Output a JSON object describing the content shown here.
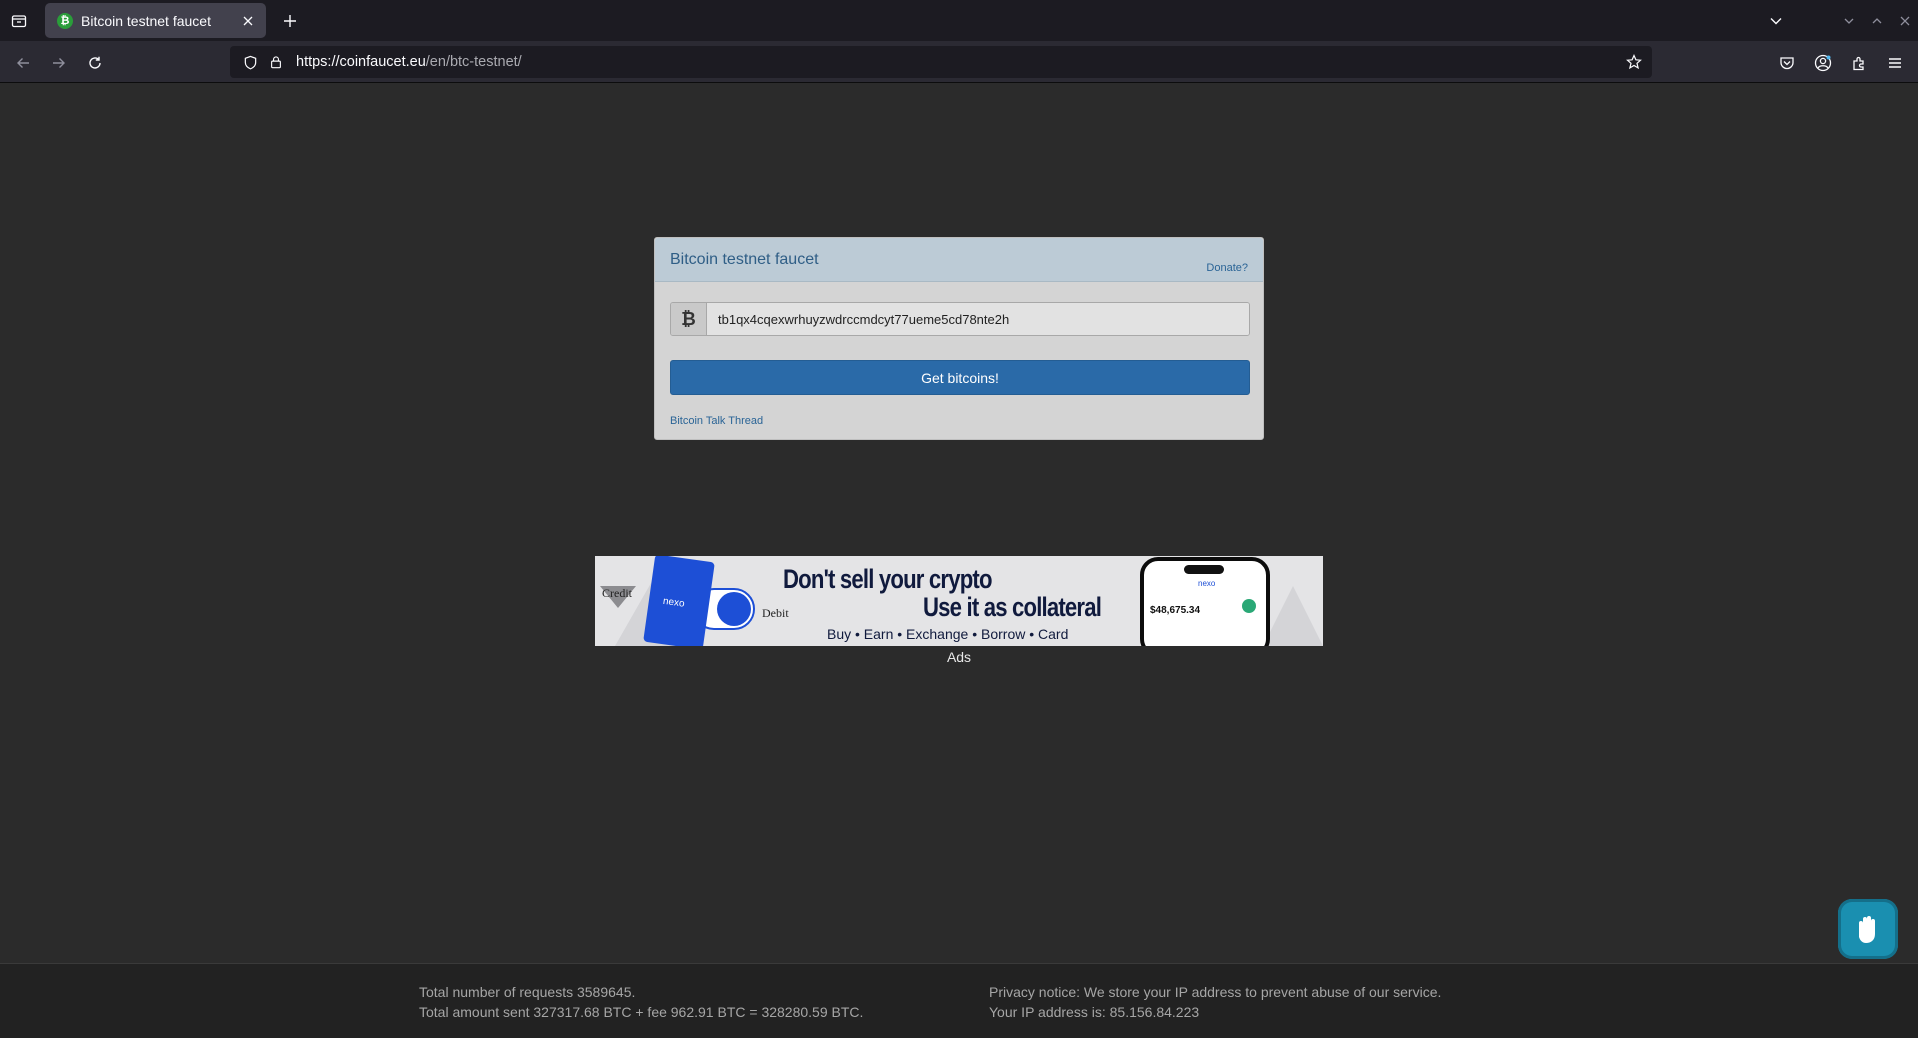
{
  "browser": {
    "tab_title": "Bitcoin testnet faucet",
    "url_host": "https://coinfaucet.eu",
    "url_path": "/en/btc-testnet/"
  },
  "faucet": {
    "title": "Bitcoin testnet faucet",
    "donate_label": "Donate?",
    "currency_icon": "₿",
    "address_value": "tb1qx4cqexwrhuyzwdrccmdcyt77ueme5cd78nte2h",
    "button_label": "Get bitcoins!",
    "thread_link": "Bitcoin Talk Thread"
  },
  "ad": {
    "credit": "Credit",
    "debit": "Debit",
    "card_logo": "nexo",
    "headline1": "Don't sell your crypto",
    "headline2": "Use it as collateral",
    "subline": "Buy • Earn • Exchange • Borrow • Card",
    "phone_brand": "nexo",
    "phone_balance": "$48,675.34",
    "label": "Ads"
  },
  "footer": {
    "requests": "Total number of requests 3589645.",
    "amount": "Total amount sent 327317.68 BTC + fee 962.91 BTC = 328280.59 BTC.",
    "privacy": "Privacy notice: We store your IP address to prevent abuse of our service.",
    "ip": "Your IP address is: 85.156.84.223"
  },
  "colors": {
    "page_bg": "#2b2b2b",
    "panel_heading": "#bccbd6",
    "button": "#2a6aa8",
    "link": "#2a6496"
  }
}
